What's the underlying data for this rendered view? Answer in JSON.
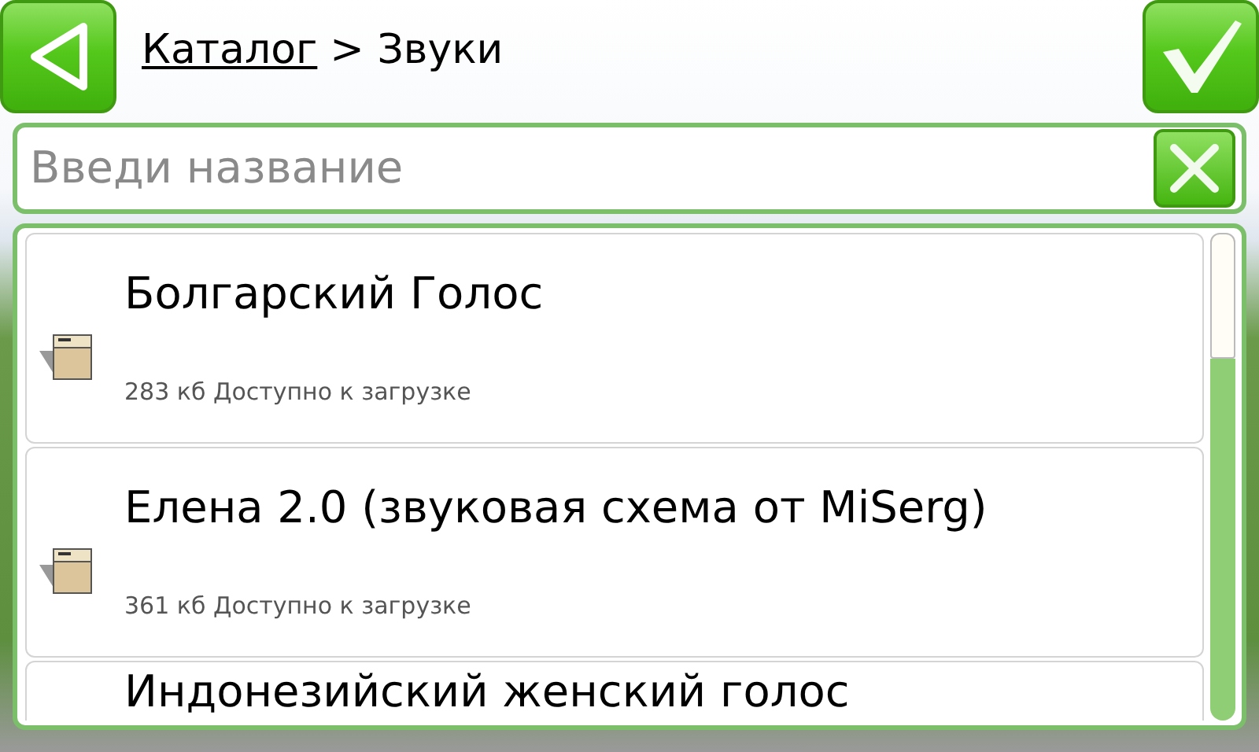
{
  "header": {
    "breadcrumb": [
      {
        "label": "Каталог",
        "link": true
      },
      {
        "label": "> Звуки",
        "link": false
      }
    ]
  },
  "search": {
    "placeholder": "Введи название"
  },
  "items": [
    {
      "title": "Болгарский Голос",
      "detail": "283 кб Доступно к загрузке"
    },
    {
      "title": "Елена 2.0 (звуковая схема от MiSerg)",
      "detail": "361 кб Доступно к загрузке"
    },
    {
      "title": "Индонезийский женский голос"
    }
  ]
}
